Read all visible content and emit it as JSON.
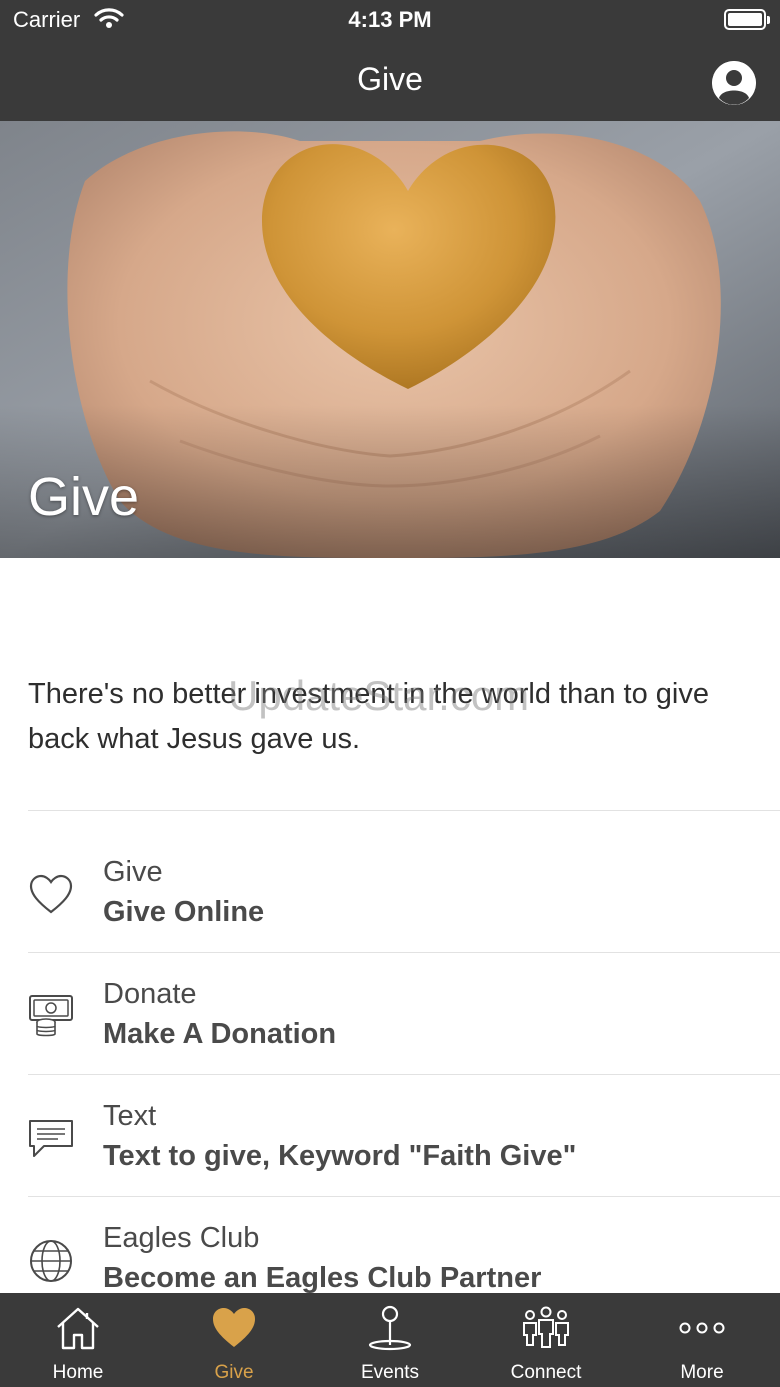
{
  "status_bar": {
    "carrier": "Carrier",
    "time": "4:13 PM"
  },
  "nav": {
    "title": "Give"
  },
  "hero": {
    "title": "Give"
  },
  "intro": {
    "text": "There's no better investment in the world than to give back what Jesus gave us.",
    "watermark": "UpdateStar.com"
  },
  "items": [
    {
      "title": "Give",
      "subtitle": "Give Online",
      "icon": "heart-outline-icon"
    },
    {
      "title": "Donate",
      "subtitle": "Make A Donation",
      "icon": "money-coins-icon"
    },
    {
      "title": "Text",
      "subtitle": "Text to give, Keyword \"Faith Give\"",
      "icon": "chat-bubble-icon"
    },
    {
      "title": "Eagles Club",
      "subtitle": "Become an Eagles Club Partner",
      "icon": "globe-icon"
    }
  ],
  "tabs": [
    {
      "label": "Home",
      "icon": "home-icon"
    },
    {
      "label": "Give",
      "icon": "heart-icon",
      "active": true
    },
    {
      "label": "Events",
      "icon": "location-pin-icon"
    },
    {
      "label": "Connect",
      "icon": "people-icon"
    },
    {
      "label": "More",
      "icon": "more-dots-icon"
    }
  ],
  "colors": {
    "bar": "#3a3a3a",
    "accent": "#d9a24a",
    "text": "#4a4a4a"
  }
}
